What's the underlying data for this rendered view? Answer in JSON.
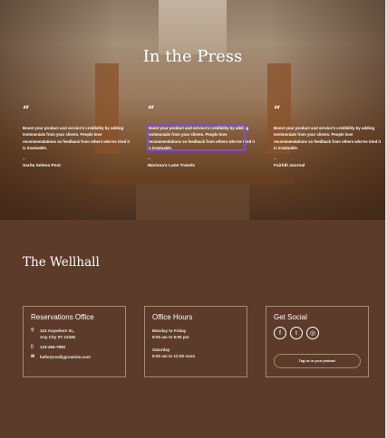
{
  "hero": {
    "title": "In the Press",
    "quotes": [
      {
        "text": "Boost your product and service's credibility by adding testimonials from your clients. People love recommendations so feedback from others who've tried it is invaluable.",
        "source": "Sarita Selena Post"
      },
      {
        "text": "Boost your product and service's credibility by adding testimonials from your clients. People love recommendations so feedback from others who've tried it is invaluable.",
        "source": "Marissa's Lane Travels"
      },
      {
        "text": "Boost your product and service's credibility by adding testimonials from your clients. People love recommendations so feedback from others who've tried it is invaluable.",
        "source": "Fairhill Journal"
      }
    ],
    "quote_mark": "“",
    "dash": "–"
  },
  "footer": {
    "brand": "The Wellhall",
    "reservations": {
      "title": "Reservations Office",
      "address1": "123 Anywhere St.,",
      "address2": "Any City ST 12345",
      "phone": "123-456-7890",
      "email": "hello@reallygreatsite.com"
    },
    "hours": {
      "title": "Office Hours",
      "weekday": "Monday to Friday",
      "weekday_time": "9:00 am to 6:00 pm",
      "saturday": "Saturday",
      "saturday_time": "9:00 am to 12:00 noon"
    },
    "social": {
      "title": "Get Social",
      "icons": [
        "facebook-icon",
        "twitter-icon",
        "instagram-icon"
      ],
      "button": "Tag us in your photos!"
    }
  },
  "colors": {
    "footer_bg": "#5c3b2a",
    "highlight": "#7c4ddc",
    "border": "#a38c6e"
  }
}
